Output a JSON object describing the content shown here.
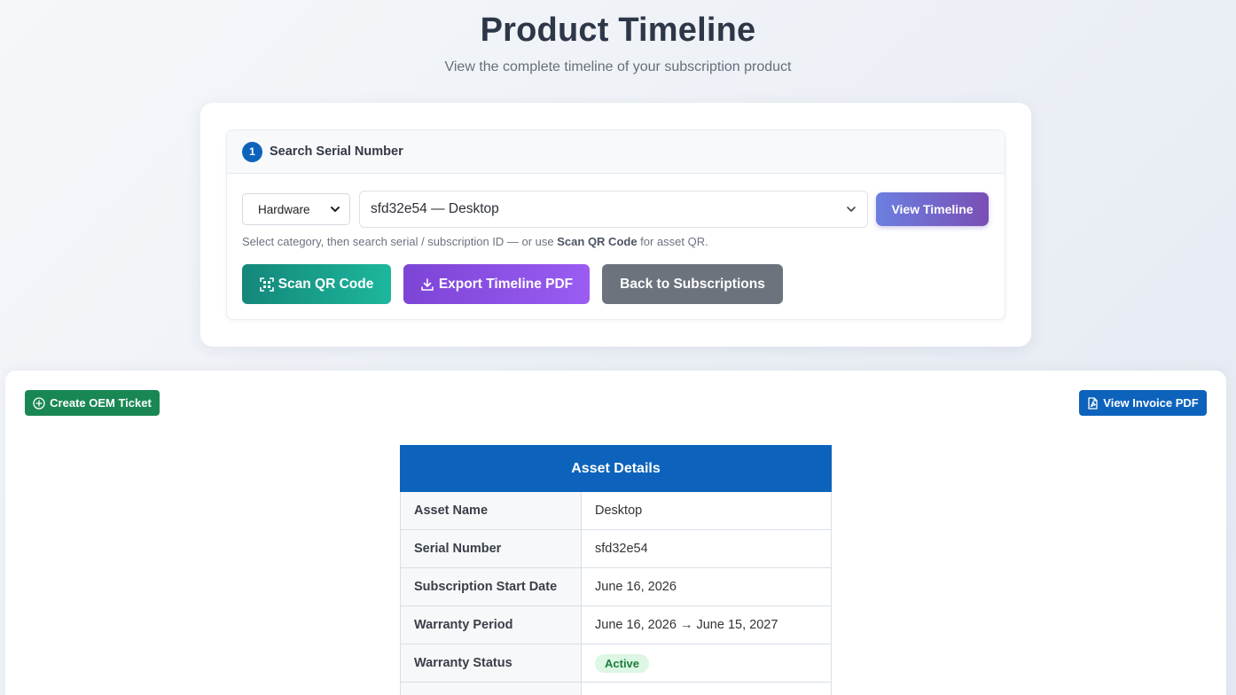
{
  "header": {
    "title": "Product Timeline",
    "subtitle": "View the complete timeline of your subscription product"
  },
  "search": {
    "step_number": "1",
    "step_title": "Search Serial Number",
    "category_value": "Hardware",
    "serial_value": "sfd32e54 — Desktop",
    "view_timeline_label": "View Timeline",
    "helper_prefix": "Select category, then search serial / subscription ID — or use ",
    "helper_bold": "Scan QR Code",
    "helper_suffix": " for asset QR.",
    "scan_label": "Scan QR Code",
    "export_label": "Export Timeline PDF",
    "back_label": "Back to Subscriptions"
  },
  "content": {
    "oem_label": "Create OEM Ticket",
    "invoice_label": "View Invoice PDF"
  },
  "asset_details": {
    "title": "Asset Details",
    "rows": [
      {
        "label": "Asset Name",
        "value": "Desktop"
      },
      {
        "label": "Serial Number",
        "value": "sfd32e54"
      },
      {
        "label": "Subscription Start Date",
        "value": "June 16, 2026"
      },
      {
        "label": "Warranty Period",
        "value": "June 16, 2026 → June 15, 2027"
      },
      {
        "label": "Warranty Status",
        "value": "Active"
      }
    ]
  },
  "colors": {
    "primary": "#0d63bb",
    "success": "#198754",
    "status_active_bg": "#dcf7e3",
    "status_active_text": "#1e7d3c"
  }
}
